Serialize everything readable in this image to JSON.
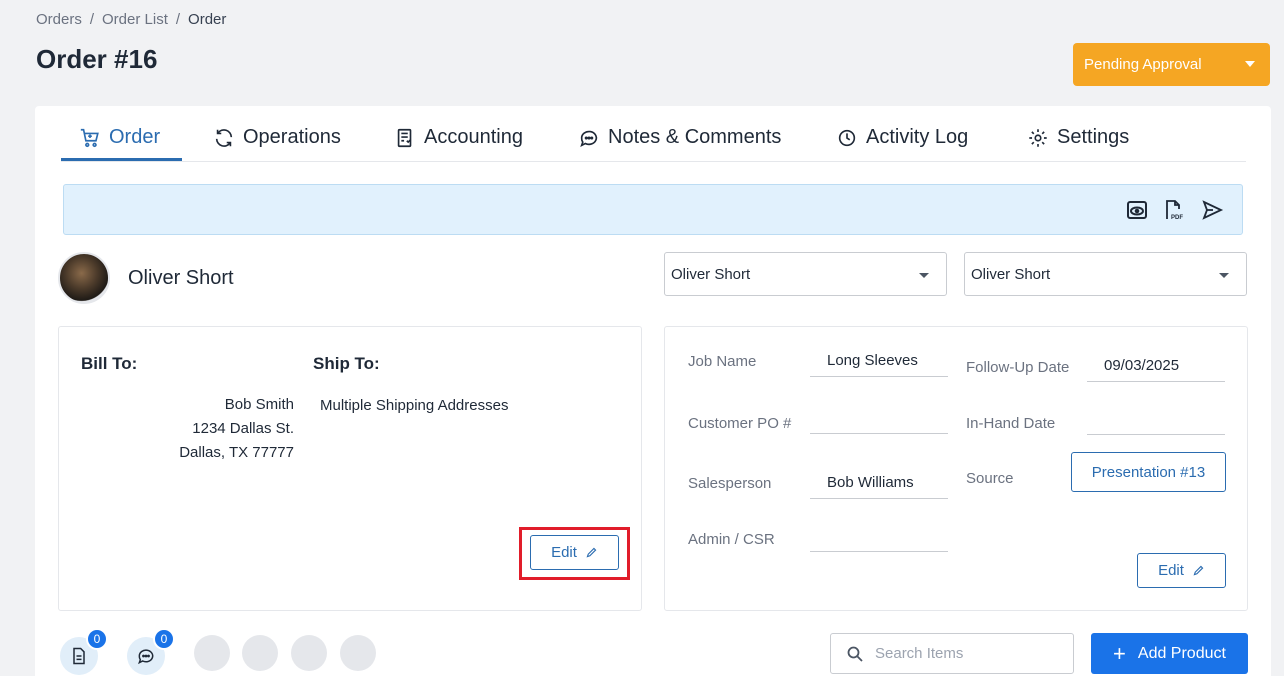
{
  "breadcrumb": {
    "items": [
      "Orders",
      "Order List"
    ],
    "current": "Order",
    "sep": "/"
  },
  "page_title": "Order #16",
  "status": {
    "label": "Pending Approval",
    "color": "#f5a623"
  },
  "tabs": [
    {
      "label": "Order",
      "icon": "cart-icon",
      "active": true
    },
    {
      "label": "Operations",
      "icon": "refresh-icon"
    },
    {
      "label": "Accounting",
      "icon": "ledger-icon"
    },
    {
      "label": "Notes & Comments",
      "icon": "chat-icon"
    },
    {
      "label": "Activity Log",
      "icon": "clock-icon"
    },
    {
      "label": "Settings",
      "icon": "gear-icon"
    }
  ],
  "toolbar": {
    "icons": [
      "preview-icon",
      "pdf-icon",
      "send-icon"
    ],
    "pdf_text": "PDF"
  },
  "customer": {
    "name": "Oliver Short"
  },
  "selects": [
    {
      "value": "Oliver Short"
    },
    {
      "value": "Oliver Short"
    }
  ],
  "address": {
    "bill_to_label": "Bill To:",
    "ship_to_label": "Ship To:",
    "bill_lines": [
      "Bob Smith",
      "1234 Dallas St.",
      "Dallas, TX 77777"
    ],
    "ship_text": "Multiple Shipping Addresses",
    "edit_label": "Edit"
  },
  "details": {
    "job_name": {
      "label": "Job Name",
      "value": "Long Sleeves"
    },
    "customer_po": {
      "label": "Customer PO #",
      "value": ""
    },
    "salesperson": {
      "label": "Salesperson",
      "value": "Bob Williams"
    },
    "admin_csr": {
      "label": "Admin / CSR",
      "value": ""
    },
    "follow_up": {
      "label": "Follow-Up Date",
      "value": "09/03/2025"
    },
    "in_hand": {
      "label": "In-Hand Date",
      "value": ""
    },
    "source": {
      "label": "Source",
      "value": "Presentation #13"
    },
    "edit_label": "Edit"
  },
  "footer": {
    "doc_badge": "0",
    "chat_badge": "0",
    "search_placeholder": "Search Items",
    "add_product_label": "Add Product"
  },
  "colors": {
    "accent": "#2b6cb0",
    "primary": "#1a73e8",
    "highlight": "#e11d2a"
  }
}
